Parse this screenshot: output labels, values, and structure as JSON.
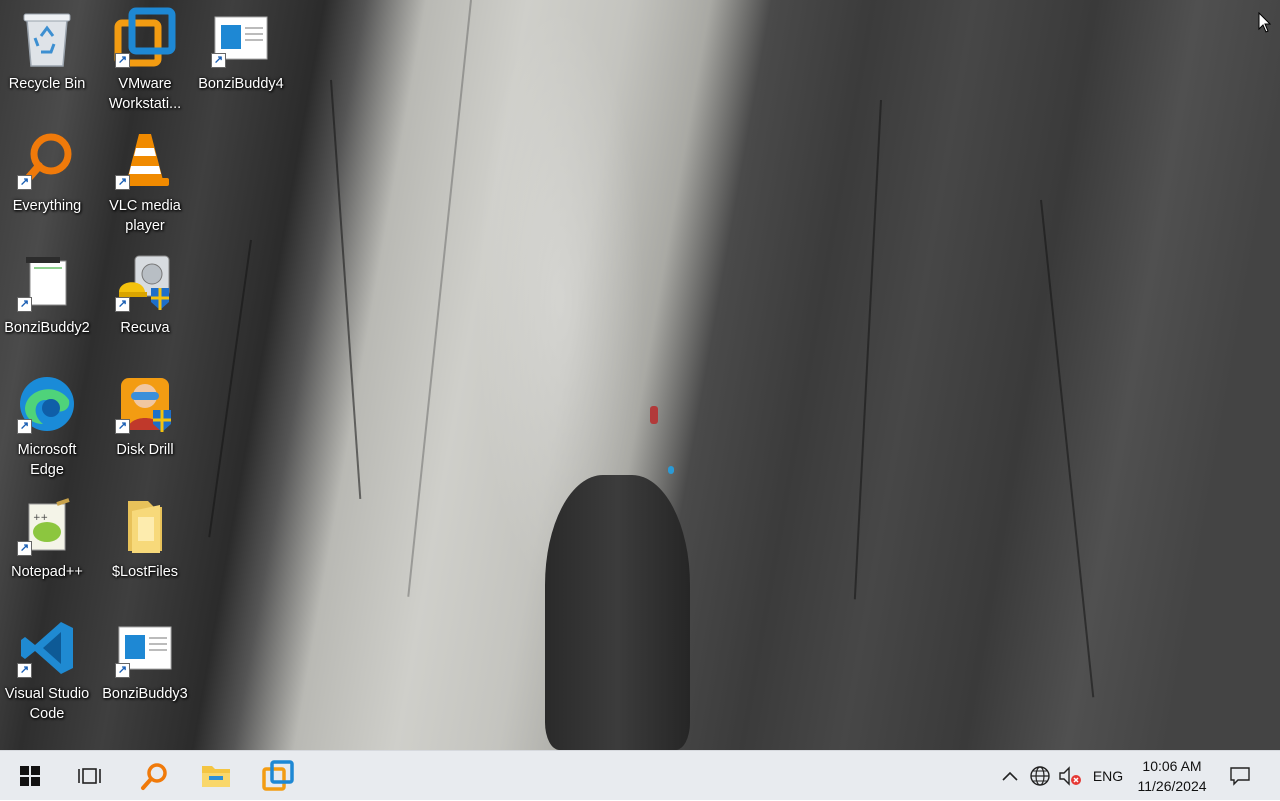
{
  "desktop": {
    "icons": [
      {
        "label": "Recycle Bin",
        "icon": "recycle-bin-icon"
      },
      {
        "label": "VMware Workstati...",
        "icon": "vmware-icon"
      },
      {
        "label": "BonziBuddy4",
        "icon": "document-icon"
      },
      {
        "label": "Everything",
        "icon": "search-icon"
      },
      {
        "label": "VLC media player",
        "icon": "vlc-cone-icon"
      },
      {
        "label": "BonziBuddy2",
        "icon": "document-icon"
      },
      {
        "label": "Recuva",
        "icon": "recuva-icon"
      },
      {
        "label": "Microsoft Edge",
        "icon": "edge-icon"
      },
      {
        "label": "Disk Drill",
        "icon": "disk-drill-icon"
      },
      {
        "label": "Notepad++",
        "icon": "notepad-plus-plus-icon"
      },
      {
        "label": "$LostFiles",
        "icon": "folder-icon"
      },
      {
        "label": "Visual Studio Code",
        "icon": "vscode-icon"
      },
      {
        "label": "BonziBuddy3",
        "icon": "document-icon"
      }
    ]
  },
  "taskbar": {
    "start": "windows-logo-icon",
    "pinned": [
      "task-view-icon",
      "search-icon",
      "file-explorer-icon",
      "vmware-icon"
    ],
    "tray": {
      "chevron": "chevron-up-icon",
      "network": "network-globe-icon",
      "volume": "volume-muted-icon",
      "language": "ENG"
    },
    "clock": {
      "time": "10:06 AM",
      "date": "11/26/2024"
    },
    "notifications": "notification-icon"
  },
  "colors": {
    "taskbar_bg": "#e8ebef",
    "accent_blue": "#1e88d4",
    "vmware_orange": "#f39c12",
    "search_orange": "#f07a0a"
  }
}
